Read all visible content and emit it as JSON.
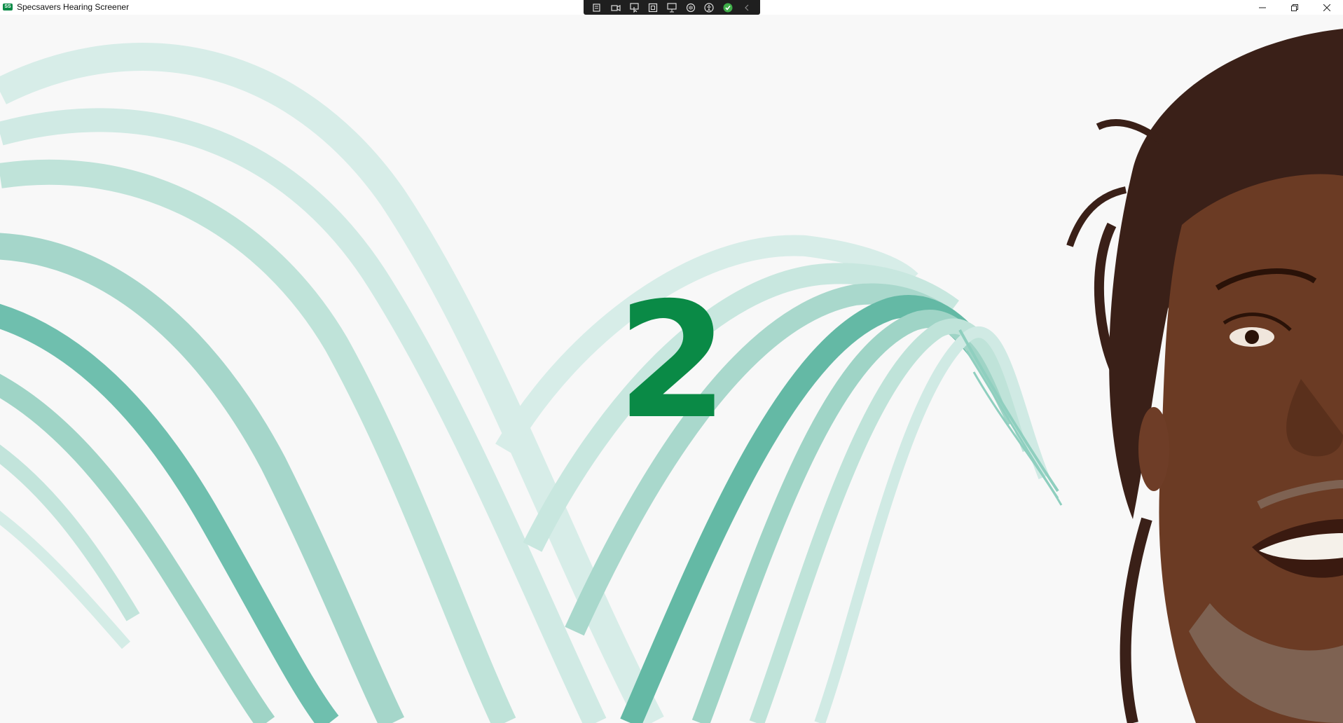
{
  "window": {
    "title": "Specsavers Hearing Screener",
    "icon": "specsavers-app-icon",
    "controls": [
      "minimize-icon",
      "restore-icon",
      "close-icon"
    ]
  },
  "toolbar": {
    "icons": [
      "record-list-icon",
      "camera-icon",
      "select-pointer-icon",
      "frame-icon",
      "screen-share-icon",
      "audio-icon",
      "accessibility-icon",
      "check-icon",
      "chevron-left-icon"
    ]
  },
  "main": {
    "countdown_number": "2"
  },
  "colors": {
    "brand_green": "#0a8a46",
    "ribbon_light": "#d5ece6",
    "ribbon_mid": "#9fd4c6",
    "ribbon_dark": "#5fb8a4",
    "background": "#f8f8f8"
  }
}
